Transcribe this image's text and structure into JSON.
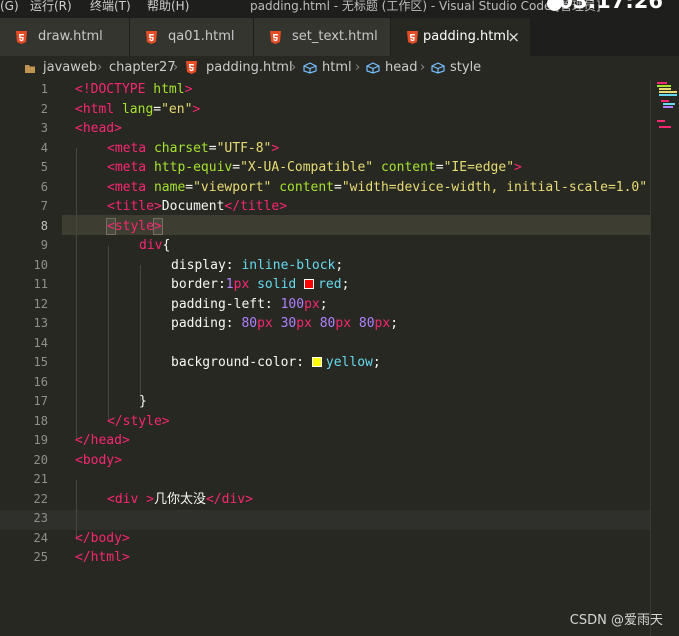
{
  "menubar": {
    "items": [
      "(G)",
      "运行(R)",
      "终端(T)",
      "帮助(H)"
    ],
    "window_title": "padding.html - 无标题 (工作区) - Visual Studio Code [管理员]",
    "clock": "03:17:26"
  },
  "tabs": [
    {
      "label": "draw.html",
      "active": false
    },
    {
      "label": "qa01.html",
      "active": false
    },
    {
      "label": "set_text.html",
      "active": false
    },
    {
      "label": "padding.html",
      "active": true,
      "close": "×"
    }
  ],
  "breadcrumb": {
    "items": [
      "javaweb",
      "chapter27",
      "padding.html",
      "html",
      "head",
      "style"
    ],
    "separator": "›"
  },
  "editor": {
    "line_numbers": [
      "1",
      "2",
      "3",
      "4",
      "5",
      "6",
      "7",
      "8",
      "9",
      "10",
      "11",
      "12",
      "13",
      "14",
      "15",
      "16",
      "17",
      "18",
      "19",
      "20",
      "21",
      "22",
      "23",
      "24",
      "25"
    ],
    "current_line": "8",
    "code": {
      "l1_doctype": "<!DOCTYPE",
      "l1_html": "html",
      "l1_end": ">",
      "l2_open": "<html",
      "l2_attr": "lang",
      "l2_val": "\"en\"",
      "l3_head": "<head>",
      "l4_tag": "<meta",
      "l4_attr": "charset",
      "l4_val": "\"UTF-8\"",
      "l5_tag": "<meta",
      "l5_attr1": "http-equiv",
      "l5_val1": "\"X-UA-Compatible\"",
      "l5_attr2": "content",
      "l5_val2": "\"IE=edge\"",
      "l6_tag": "<meta",
      "l6_attr1": "name",
      "l6_val1": "\"viewport\"",
      "l6_attr2": "content",
      "l6_val2": "\"width=device-width, initial-scale=1.0\"",
      "l7_open": "<title>",
      "l7_text": "Document",
      "l7_close": "</title>",
      "l8_lt": "<",
      "l8_tag": "style",
      "l8_gt": ">",
      "l9_sel": "div",
      "l9_brace": "{",
      "l10_prop": "display",
      "l10_val": "inline-block",
      "l11_prop": "border",
      "l11_num": "1",
      "l11_unit": "px",
      "l11_solid": "solid",
      "l11_color": "red",
      "l11_swatch": "#ff0000",
      "l12_prop": "padding-left",
      "l12_num": "100",
      "l12_unit": "px",
      "l13_prop": "padding",
      "l13_n1": "80",
      "l13_n2": "30",
      "l13_n3": "80",
      "l13_n4": "80",
      "l13_unit": "px",
      "l15_prop": "background-color",
      "l15_color": "yellow",
      "l15_swatch": "#ffff00",
      "l17_brace": "}",
      "l18_close": "</style>",
      "l19_close": "</head>",
      "l20_open": "<body>",
      "l22_open": "<div",
      "l22_gt": ">",
      "l22_text": "几你太没",
      "l22_close": "</div>",
      "l24_close": "</body>",
      "l25_close": "</html>"
    }
  },
  "watermark": "CSDN @爱雨天",
  "colors": {
    "background": "#272822",
    "tag": "#f92672",
    "attribute": "#a6e22e",
    "string": "#e6db74",
    "keyword": "#66d9ef",
    "number": "#ae81ff",
    "html5_icon": "#e44d26"
  }
}
